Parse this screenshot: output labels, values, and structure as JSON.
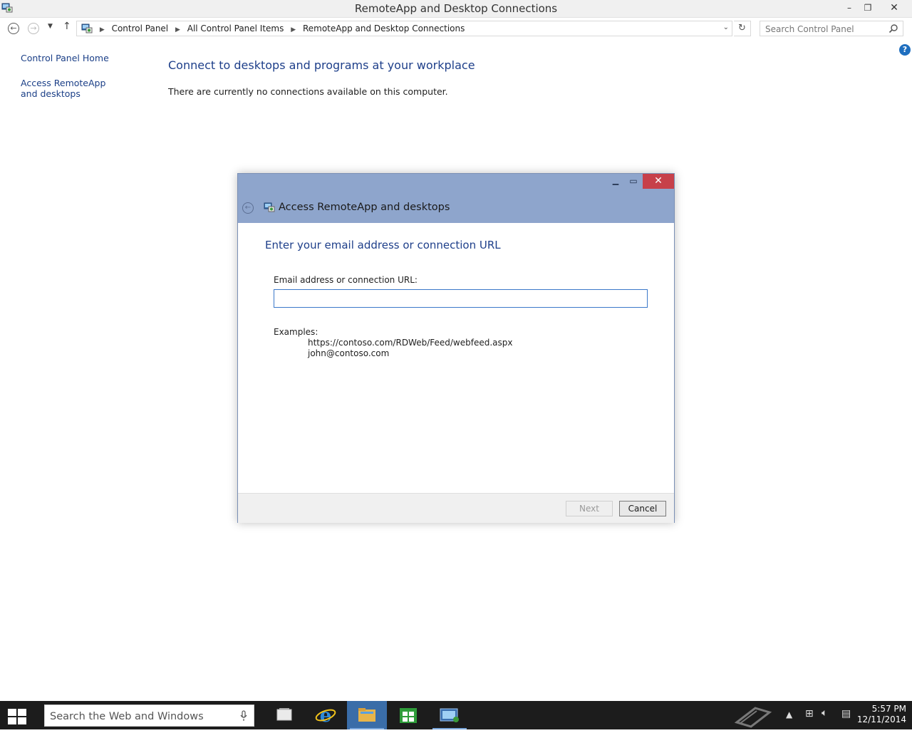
{
  "window": {
    "title": "RemoteApp and Desktop Connections",
    "caption": {
      "minimize": "–",
      "restore": "❐",
      "close": "✕"
    }
  },
  "navbar": {
    "breadcrumbs": [
      "Control Panel",
      "All Control Panel Items",
      "RemoteApp and Desktop Connections"
    ],
    "search_placeholder": "Search Control Panel"
  },
  "left_pane": {
    "links": [
      "Control Panel Home",
      "Access RemoteApp and desktops"
    ]
  },
  "main": {
    "heading": "Connect to desktops and programs at your workplace",
    "status_text": "There are currently no connections available on this computer."
  },
  "dialog": {
    "title": "Access RemoteApp and desktops",
    "heading": "Enter your email address or connection URL",
    "field_label": "Email address or connection URL:",
    "field_value": "",
    "examples_label": "Examples:",
    "examples": [
      "https://contoso.com/RDWeb/Feed/webfeed.aspx",
      "john@contoso.com"
    ],
    "next_label": "Next",
    "cancel_label": "Cancel",
    "header_color": "#8ea5cc",
    "close_color": "#c7404a"
  },
  "taskbar": {
    "search_placeholder": "Search the Web and Windows",
    "apps": [
      "task-view-icon",
      "internet-explorer-icon",
      "file-explorer-icon",
      "store-icon",
      "remoteapp-icon"
    ],
    "clock_time": "5:57 PM",
    "clock_date": "12/11/2014"
  }
}
